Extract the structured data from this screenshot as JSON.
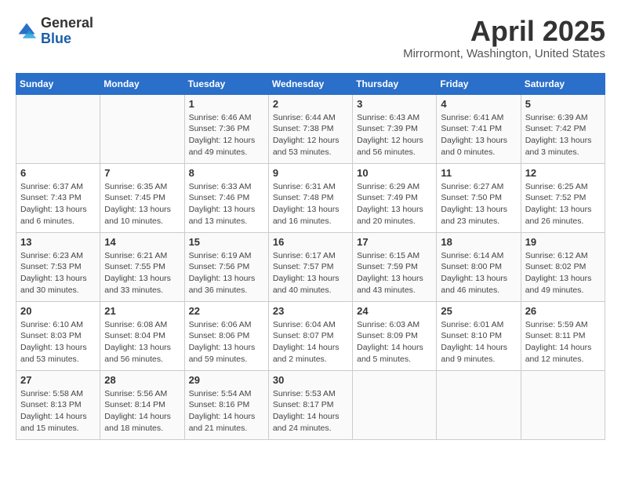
{
  "header": {
    "logo": {
      "line1": "General",
      "line2": "Blue"
    },
    "title": "April 2025",
    "subtitle": "Mirrormont, Washington, United States"
  },
  "calendar": {
    "days_of_week": [
      "Sunday",
      "Monday",
      "Tuesday",
      "Wednesday",
      "Thursday",
      "Friday",
      "Saturday"
    ],
    "weeks": [
      [
        {
          "day": "",
          "info": ""
        },
        {
          "day": "",
          "info": ""
        },
        {
          "day": "1",
          "info": "Sunrise: 6:46 AM\nSunset: 7:36 PM\nDaylight: 12 hours\nand 49 minutes."
        },
        {
          "day": "2",
          "info": "Sunrise: 6:44 AM\nSunset: 7:38 PM\nDaylight: 12 hours\nand 53 minutes."
        },
        {
          "day": "3",
          "info": "Sunrise: 6:43 AM\nSunset: 7:39 PM\nDaylight: 12 hours\nand 56 minutes."
        },
        {
          "day": "4",
          "info": "Sunrise: 6:41 AM\nSunset: 7:41 PM\nDaylight: 13 hours\nand 0 minutes."
        },
        {
          "day": "5",
          "info": "Sunrise: 6:39 AM\nSunset: 7:42 PM\nDaylight: 13 hours\nand 3 minutes."
        }
      ],
      [
        {
          "day": "6",
          "info": "Sunrise: 6:37 AM\nSunset: 7:43 PM\nDaylight: 13 hours\nand 6 minutes."
        },
        {
          "day": "7",
          "info": "Sunrise: 6:35 AM\nSunset: 7:45 PM\nDaylight: 13 hours\nand 10 minutes."
        },
        {
          "day": "8",
          "info": "Sunrise: 6:33 AM\nSunset: 7:46 PM\nDaylight: 13 hours\nand 13 minutes."
        },
        {
          "day": "9",
          "info": "Sunrise: 6:31 AM\nSunset: 7:48 PM\nDaylight: 13 hours\nand 16 minutes."
        },
        {
          "day": "10",
          "info": "Sunrise: 6:29 AM\nSunset: 7:49 PM\nDaylight: 13 hours\nand 20 minutes."
        },
        {
          "day": "11",
          "info": "Sunrise: 6:27 AM\nSunset: 7:50 PM\nDaylight: 13 hours\nand 23 minutes."
        },
        {
          "day": "12",
          "info": "Sunrise: 6:25 AM\nSunset: 7:52 PM\nDaylight: 13 hours\nand 26 minutes."
        }
      ],
      [
        {
          "day": "13",
          "info": "Sunrise: 6:23 AM\nSunset: 7:53 PM\nDaylight: 13 hours\nand 30 minutes."
        },
        {
          "day": "14",
          "info": "Sunrise: 6:21 AM\nSunset: 7:55 PM\nDaylight: 13 hours\nand 33 minutes."
        },
        {
          "day": "15",
          "info": "Sunrise: 6:19 AM\nSunset: 7:56 PM\nDaylight: 13 hours\nand 36 minutes."
        },
        {
          "day": "16",
          "info": "Sunrise: 6:17 AM\nSunset: 7:57 PM\nDaylight: 13 hours\nand 40 minutes."
        },
        {
          "day": "17",
          "info": "Sunrise: 6:15 AM\nSunset: 7:59 PM\nDaylight: 13 hours\nand 43 minutes."
        },
        {
          "day": "18",
          "info": "Sunrise: 6:14 AM\nSunset: 8:00 PM\nDaylight: 13 hours\nand 46 minutes."
        },
        {
          "day": "19",
          "info": "Sunrise: 6:12 AM\nSunset: 8:02 PM\nDaylight: 13 hours\nand 49 minutes."
        }
      ],
      [
        {
          "day": "20",
          "info": "Sunrise: 6:10 AM\nSunset: 8:03 PM\nDaylight: 13 hours\nand 53 minutes."
        },
        {
          "day": "21",
          "info": "Sunrise: 6:08 AM\nSunset: 8:04 PM\nDaylight: 13 hours\nand 56 minutes."
        },
        {
          "day": "22",
          "info": "Sunrise: 6:06 AM\nSunset: 8:06 PM\nDaylight: 13 hours\nand 59 minutes."
        },
        {
          "day": "23",
          "info": "Sunrise: 6:04 AM\nSunset: 8:07 PM\nDaylight: 14 hours\nand 2 minutes."
        },
        {
          "day": "24",
          "info": "Sunrise: 6:03 AM\nSunset: 8:09 PM\nDaylight: 14 hours\nand 5 minutes."
        },
        {
          "day": "25",
          "info": "Sunrise: 6:01 AM\nSunset: 8:10 PM\nDaylight: 14 hours\nand 9 minutes."
        },
        {
          "day": "26",
          "info": "Sunrise: 5:59 AM\nSunset: 8:11 PM\nDaylight: 14 hours\nand 12 minutes."
        }
      ],
      [
        {
          "day": "27",
          "info": "Sunrise: 5:58 AM\nSunset: 8:13 PM\nDaylight: 14 hours\nand 15 minutes."
        },
        {
          "day": "28",
          "info": "Sunrise: 5:56 AM\nSunset: 8:14 PM\nDaylight: 14 hours\nand 18 minutes."
        },
        {
          "day": "29",
          "info": "Sunrise: 5:54 AM\nSunset: 8:16 PM\nDaylight: 14 hours\nand 21 minutes."
        },
        {
          "day": "30",
          "info": "Sunrise: 5:53 AM\nSunset: 8:17 PM\nDaylight: 14 hours\nand 24 minutes."
        },
        {
          "day": "",
          "info": ""
        },
        {
          "day": "",
          "info": ""
        },
        {
          "day": "",
          "info": ""
        }
      ]
    ]
  }
}
